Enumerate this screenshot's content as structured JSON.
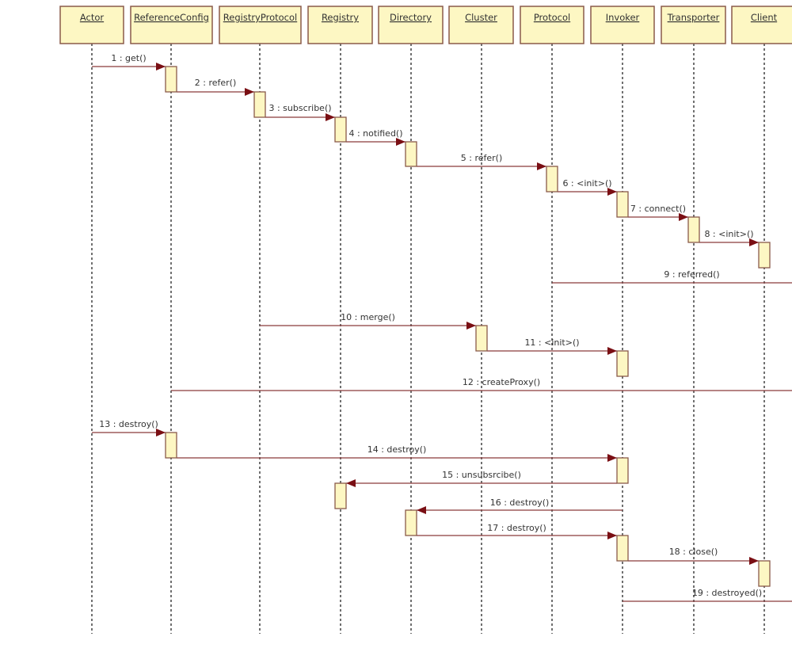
{
  "diagram": {
    "type": "sequence",
    "colors": {
      "box_fill": "#fdf7c3",
      "box_stroke": "#8a5a4a",
      "message_line": "#8b3a3a",
      "arrow_head": "#7a0f14",
      "lifeline": "#333333",
      "text": "#333333"
    },
    "participants": [
      {
        "id": "actor",
        "label": "Actor"
      },
      {
        "id": "referenceconfig",
        "label": "ReferenceConfig"
      },
      {
        "id": "registryprotocol",
        "label": "RegistryProtocol"
      },
      {
        "id": "registry",
        "label": "Registry"
      },
      {
        "id": "directory",
        "label": "Directory"
      },
      {
        "id": "cluster",
        "label": "Cluster"
      },
      {
        "id": "protocol",
        "label": "Protocol"
      },
      {
        "id": "invoker",
        "label": "Invoker"
      },
      {
        "id": "transporter",
        "label": "Transporter"
      },
      {
        "id": "client",
        "label": "Client"
      }
    ],
    "messages": [
      {
        "label": "1 : get()",
        "from": "actor",
        "to": "referenceconfig",
        "arrow": true
      },
      {
        "label": "2 : refer()",
        "from": "referenceconfig",
        "to": "registryprotocol",
        "arrow": true
      },
      {
        "label": "3 : subscribe()",
        "from": "registryprotocol",
        "to": "registry",
        "arrow": true
      },
      {
        "label": "4 : notified()",
        "from": "registry",
        "to": "directory",
        "arrow": true
      },
      {
        "label": "5 : refer()",
        "from": "directory",
        "to": "protocol",
        "arrow": true
      },
      {
        "label": "6 : <init>()",
        "from": "protocol",
        "to": "invoker",
        "arrow": true
      },
      {
        "label": "7 : connect()",
        "from": "invoker",
        "to": "transporter",
        "arrow": true
      },
      {
        "label": "8 : <init>()",
        "from": "transporter",
        "to": "client",
        "arrow": true
      },
      {
        "label": "9 : referred()",
        "from": "protocol",
        "to": "offscreen-right",
        "arrow": false
      },
      {
        "label": "10 : merge()",
        "from": "registryprotocol",
        "to": "cluster",
        "arrow": true
      },
      {
        "label": "11 : <init>()",
        "from": "cluster",
        "to": "invoker",
        "arrow": true
      },
      {
        "label": "12 : createProxy()",
        "from": "referenceconfig",
        "to": "offscreen-right",
        "arrow": false
      },
      {
        "label": "13 : destroy()",
        "from": "actor",
        "to": "referenceconfig",
        "arrow": true
      },
      {
        "label": "14 : destroy()",
        "from": "referenceconfig",
        "to": "invoker",
        "arrow": true
      },
      {
        "label": "15 : unsubsrcibe()",
        "from": "invoker",
        "to": "registry",
        "arrow": true
      },
      {
        "label": "16 : destroy()",
        "from": "invoker",
        "to": "directory",
        "arrow": true
      },
      {
        "label": "17 : destroy()",
        "from": "directory",
        "to": "invoker",
        "arrow": true
      },
      {
        "label": "18 : close()",
        "from": "invoker",
        "to": "client",
        "arrow": true
      },
      {
        "label": "19 : destroyed()",
        "from": "invoker",
        "to": "offscreen-right",
        "arrow": false
      }
    ]
  }
}
